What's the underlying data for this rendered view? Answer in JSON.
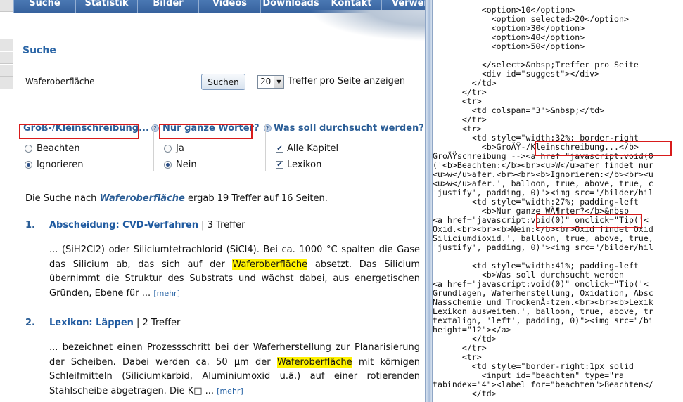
{
  "nav": {
    "items": [
      "Suche",
      "Statistik",
      "Bilder",
      "Videos",
      "Downloads",
      "Kontakt",
      "Verweis"
    ]
  },
  "page": {
    "title": "Suche"
  },
  "search": {
    "value": "Waferoberfläche",
    "button_label": "Suchen",
    "per_page_value": "20",
    "per_page_label": "Treffer pro Seite anzeigen"
  },
  "options": {
    "case": {
      "heading": "Groß-/Kleinschreibung...",
      "opt1": "Beachten",
      "opt2": "Ignorieren",
      "selected": "Ignorieren"
    },
    "whole_words": {
      "heading": "Nur ganze Wörter?",
      "opt1": "Ja",
      "opt2": "Nein",
      "selected": "Nein"
    },
    "scope": {
      "heading": "Was soll durchsucht werden?",
      "opt1": "Alle Kapitel",
      "opt2": "Lexikon",
      "opt1_checked": true,
      "opt2_checked": true
    },
    "help_glyph": "?"
  },
  "summary": {
    "prefix": "Die Suche nach ",
    "query": "Waferoberfläche",
    "suffix": " ergab 19 Treffer auf 16 Seiten."
  },
  "results": [
    {
      "num": "1.",
      "link": "Abscheidung: CVD-Verfahren",
      "count": " | 3 Treffer",
      "before": "... (SiH2Cl2) oder Siliciumtetrachlorid (SiCl4). Bei ca. 1000 °C spalten die Gase das Silicium ab, das sich auf der ",
      "highlight": "Waferoberfläche",
      "after": " absetzt. Das Silicium übernimmt die Struktur des Substrats und wächst dabei, aus energetischen Gründen, Ebene für ... ",
      "more": "[mehr]"
    },
    {
      "num": "2.",
      "link": "Lexikon: Läppen",
      "count": " | 2 Treffer",
      "before": "... bezeichnet einen Prozessschritt bei der Waferherstellung zur Planarisierung der Scheiben. Dabei werden ca. 50 µm der ",
      "highlight": "Waferoberfläche",
      "after": " mit körnigen Schleifmitteln (Siliciumkarbid, Aluminiumoxid u.ä.) auf einer rotierenden Stahlscheibe abgetragen. Die K□ ... ",
      "more": "[mehr]"
    }
  ],
  "source": {
    "lines": [
      "          <option>10</option>",
      "            <option selected>20</option>",
      "            <option>30</option>",
      "            <option>40</option>",
      "            <option>50</option>",
      "",
      "          </select>&nbsp;Treffer pro Seite",
      "          <div id=\"suggest\"></div>",
      "        </td>",
      "      </tr>",
      "      <tr>",
      "        <td colspan=\"3\">&nbsp;</td>",
      "      </tr>",
      "      <tr>",
      "        <td style=\"width:32%; border-right",
      "          <b>GroÃŸ-/Kleinschreibung...</b>",
      "GroÃŸschreibung --><a href=\"javascript:void(0",
      "('<b>Beachten:</b><br><u>W</u>afer findet nur",
      "<u>w</u>afer.<br><br><b>Ignorieren:</b><br><u",
      "<u>w</u>afer.', balloon, true, above, true, c",
      "'justify', padding, 0)\"><img src=\"/bilder/hil",
      "        <td style=\"width:27%; padding-left",
      "          <b>Nur ganze WÃ¶rter?</b>&nbsp",
      "<a href=\"javascript:void(0)\" onclick=\"Tip('<",
      "Oxid.<br><br><b>Nein:</b><br>Oxid findet Oxid",
      "Siliciumdioxid.', balloon, true, above, true,",
      "'justify', padding, 0)\"><img src=\"/bilder/hil",
      "",
      "        <td style=\"width:41%; padding-left",
      "          <b>Was soll durchsucht werden",
      "<a href=\"javascript:void(0)\" onclick=\"Tip('<",
      "Grundlagen, Waferherstellung, Oxidation, Absc",
      "Nasschemie und TrockenÃ¤tzen.<br><br><b>Lexik",
      "Lexikon ausweiten.', balloon, true, above, tr",
      "textalign, 'left', padding, 0)\"><img src=\"/bi",
      "height=\"12\"></a>",
      "        </td>",
      "      </tr>",
      "      <tr>",
      "        <td style=\"border-right:1px solid",
      "          <input id=\"beachten\" type=\"ra",
      "tabindex=\"4\"><label for=\"beachten\">Beachten</",
      "        </td>"
    ]
  }
}
